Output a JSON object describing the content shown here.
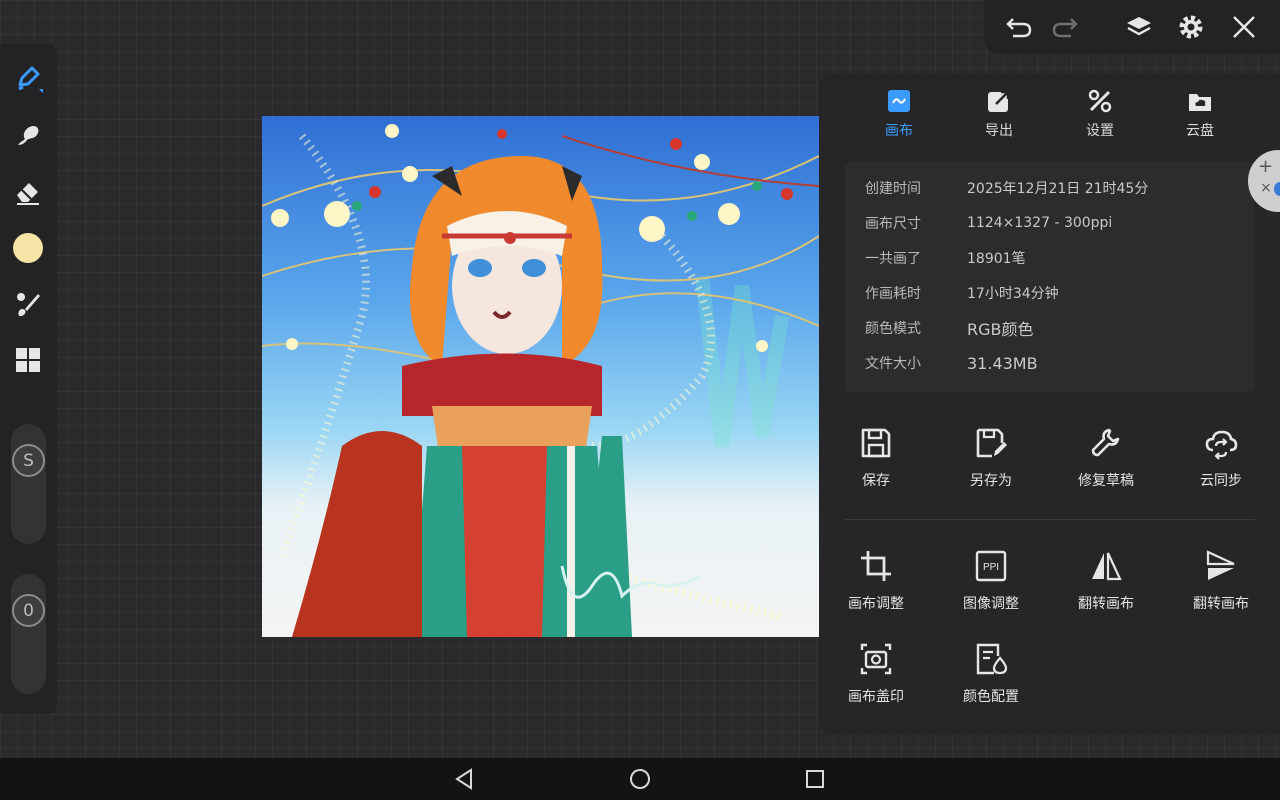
{
  "panel": {
    "tabs": [
      {
        "label": "画布",
        "icon": "canvas-icon",
        "active": true
      },
      {
        "label": "导出",
        "icon": "export-icon",
        "active": false
      },
      {
        "label": "设置",
        "icon": "settings-tools-icon",
        "active": false
      },
      {
        "label": "云盘",
        "icon": "cloud-drive-icon",
        "active": false
      }
    ],
    "info": [
      {
        "label": "创建时间",
        "value": "2025年12月21日 21时45分"
      },
      {
        "label": "画布尺寸",
        "value": "1124×1327 - 300ppi"
      },
      {
        "label": "一共画了",
        "value": "18901笔"
      },
      {
        "label": "作画耗时",
        "value": "17小时34分钟"
      },
      {
        "label": "颜色模式",
        "value": "RGB颜色"
      },
      {
        "label": "文件大小",
        "value": "31.43MB"
      }
    ],
    "actions_row1": [
      {
        "label": "保存",
        "icon": "save-icon"
      },
      {
        "label": "另存为",
        "icon": "save-as-icon"
      },
      {
        "label": "修复草稿",
        "icon": "wrench-icon"
      },
      {
        "label": "云同步",
        "icon": "cloud-sync-icon"
      }
    ],
    "actions_row2": [
      {
        "label": "画布调整",
        "icon": "crop-icon"
      },
      {
        "label": "图像调整",
        "icon": "ppi-icon",
        "icon_text": "PPI"
      },
      {
        "label": "翻转画布",
        "icon": "flip-horizontal-icon"
      },
      {
        "label": "翻转画布",
        "icon": "flip-vertical-icon"
      }
    ],
    "actions_row3": [
      {
        "label": "画布盖印",
        "icon": "camera-stamp-icon"
      },
      {
        "label": "颜色配置",
        "icon": "color-profile-icon"
      }
    ]
  },
  "toolbar": {
    "tools": [
      "brush-icon",
      "smudge-icon",
      "eraser-icon",
      "color-swatch",
      "brush-settings-icon",
      "material-grid-icon"
    ],
    "current_color": "#f6e3a6",
    "size_slider_label": "S",
    "opacity_slider_label": "0"
  },
  "topbar": {
    "icons": [
      "undo-icon",
      "redo-icon",
      "layers-icon",
      "gear-icon",
      "close-icon"
    ]
  },
  "colors": {
    "accent": "#3b9bff",
    "panel_bg": "#262628",
    "canvas_bg": "#2a2a2c"
  }
}
